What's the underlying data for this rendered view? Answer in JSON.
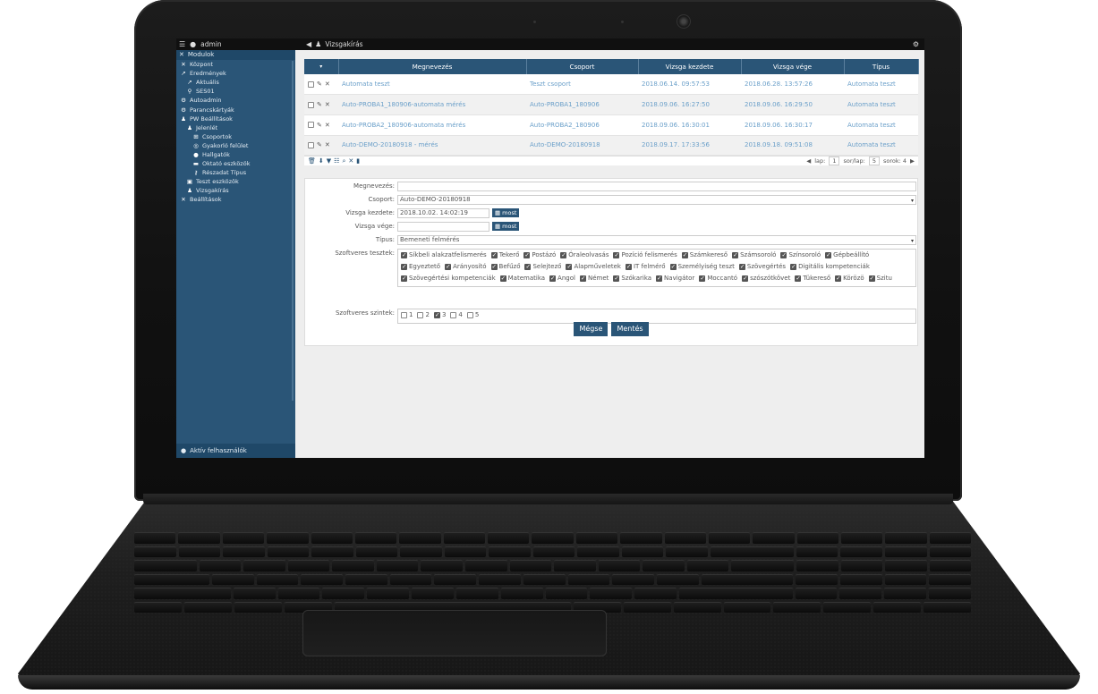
{
  "topbar": {
    "user": "admin",
    "page_title": "Vizsgakírás"
  },
  "sidebar": {
    "header": "Modulok",
    "items": [
      {
        "label": "Központ",
        "icon": "wrench-icon",
        "indent": 0
      },
      {
        "label": "Eredmények",
        "icon": "chart-icon",
        "indent": 0
      },
      {
        "label": "Aktuális",
        "icon": "chart-icon",
        "indent": 1
      },
      {
        "label": "SES01",
        "icon": "pin-icon",
        "indent": 1
      },
      {
        "label": "Autoadmin",
        "icon": "gear-icon",
        "indent": 0
      },
      {
        "label": "Parancskártyák",
        "icon": "gear-icon",
        "indent": 0
      },
      {
        "label": "PW Beállítások",
        "icon": "users-icon",
        "indent": 0
      },
      {
        "label": "Jelenlét",
        "icon": "users-icon",
        "indent": 1
      },
      {
        "label": "Csoportok",
        "icon": "sitemap-icon",
        "indent": 2
      },
      {
        "label": "Gyakorló felület",
        "icon": "target-icon",
        "indent": 2
      },
      {
        "label": "Hallgatók",
        "icon": "user-icon",
        "indent": 2
      },
      {
        "label": "Oktató eszközök",
        "icon": "monitor-icon",
        "indent": 2
      },
      {
        "label": "Részadat Típus",
        "icon": "key-icon",
        "indent": 2
      },
      {
        "label": "Teszt eszközök",
        "icon": "clipboard-icon",
        "indent": 1
      },
      {
        "label": "Vizsgakírás",
        "icon": "users-icon",
        "indent": 1
      },
      {
        "label": "Beállítások",
        "icon": "wrench-icon",
        "indent": 0
      }
    ],
    "footer": "Aktív felhasználók"
  },
  "grid": {
    "columns": [
      "Megnevezés",
      "Csoport",
      "Vizsga kezdete",
      "Vizsga vége",
      "Típus"
    ],
    "rows": [
      [
        "Automata teszt",
        "Teszt csoport",
        "2018.06.14. 09:57:53",
        "2018.06.28. 13:57:26",
        "Automata teszt"
      ],
      [
        "Auto-PROBA1_180906-automata mérés",
        "Auto-PROBA1_180906",
        "2018.09.06. 16:27:50",
        "2018.09.06. 16:29:50",
        "Automata teszt"
      ],
      [
        "Auto-PROBA2_180906-automata mérés",
        "Auto-PROBA2_180906",
        "2018.09.06. 16:30:01",
        "2018.09.06. 16:30:17",
        "Automata teszt"
      ],
      [
        "Auto-DEMO-20180918 - mérés",
        "Auto-DEMO-20180918",
        "2018.09.17. 17:33:56",
        "2018.09.18. 09:51:08",
        "Automata teszt"
      ]
    ],
    "pager": {
      "page_label": "lap:",
      "page_value": "1",
      "rows_per_page_label": "sor/lap:",
      "rows_per_page_value": "5",
      "row_count": "sorok: 4"
    }
  },
  "form": {
    "name_label": "Megnevezés:",
    "name_value": "",
    "group_label": "Csoport:",
    "group_value": "Auto-DEMO-20180918",
    "start_label": "Vizsga kezdete:",
    "start_value": "2018.10.02. 14:02:19",
    "end_label": "Vizsga vége:",
    "end_value": "",
    "now_label": "most",
    "type_label": "Típus:",
    "type_value": "Bemeneti felmérés",
    "tests_label": "Szoftveres tesztek:",
    "tests": [
      "Síkbeli alakzatfelismerés",
      "Tekerő",
      "Postázó",
      "Óraleolvasás",
      "Pozíció felismerés",
      "Számkereső",
      "Számsoroló",
      "Színsoroló",
      "Gépbeállító",
      "Egyeztető",
      "Arányosító",
      "Befűző",
      "Selejtező",
      "Alapműveletek",
      "IT felmérő",
      "Személyiség teszt",
      "Szövegértés",
      "Digitális kompetenciák",
      "Szövegértési kompetenciák",
      "Matematika",
      "Angol",
      "Német",
      "Szókarika",
      "Navigátor",
      "Moccantó",
      "szószótkövet",
      "Tükereső",
      "Körözö",
      "Szitu"
    ],
    "levels_label": "Szoftveres szintek:",
    "levels": [
      {
        "label": "1",
        "checked": false
      },
      {
        "label": "2",
        "checked": false
      },
      {
        "label": "3",
        "checked": true
      },
      {
        "label": "4",
        "checked": false
      },
      {
        "label": "5",
        "checked": false
      }
    ],
    "cancel_label": "Mégse",
    "save_label": "Mentés"
  },
  "colors": {
    "accent": "#2a5577",
    "link": "#6a9fc9",
    "topbar": "#101010"
  }
}
